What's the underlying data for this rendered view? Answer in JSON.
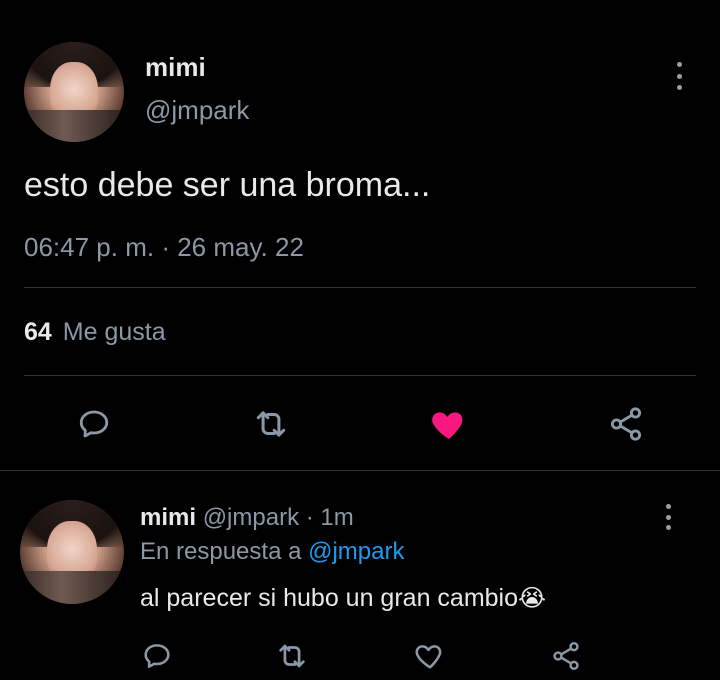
{
  "tweet": {
    "author_name": "mimi",
    "author_handle": "@jmpark",
    "text": "esto debe ser una broma...",
    "time": "06:47 p. m.",
    "separator": "·",
    "date": "26 may. 22",
    "likes_count": "64",
    "likes_label": "Me gusta",
    "liked": true,
    "like_color": "#f91880"
  },
  "reply": {
    "author_name": "mimi",
    "author_handle": "@jmpark",
    "separator": "·",
    "age": "1m",
    "replying_prefix": "En respuesta a",
    "replying_to": "@jmpark",
    "text": "al parecer si hubo un gran cambio",
    "emoji": "😭",
    "link_color": "#1d9bf0"
  },
  "icons": [
    "more-icon",
    "reply-icon",
    "retweet-icon",
    "heart-icon",
    "share-icon"
  ]
}
